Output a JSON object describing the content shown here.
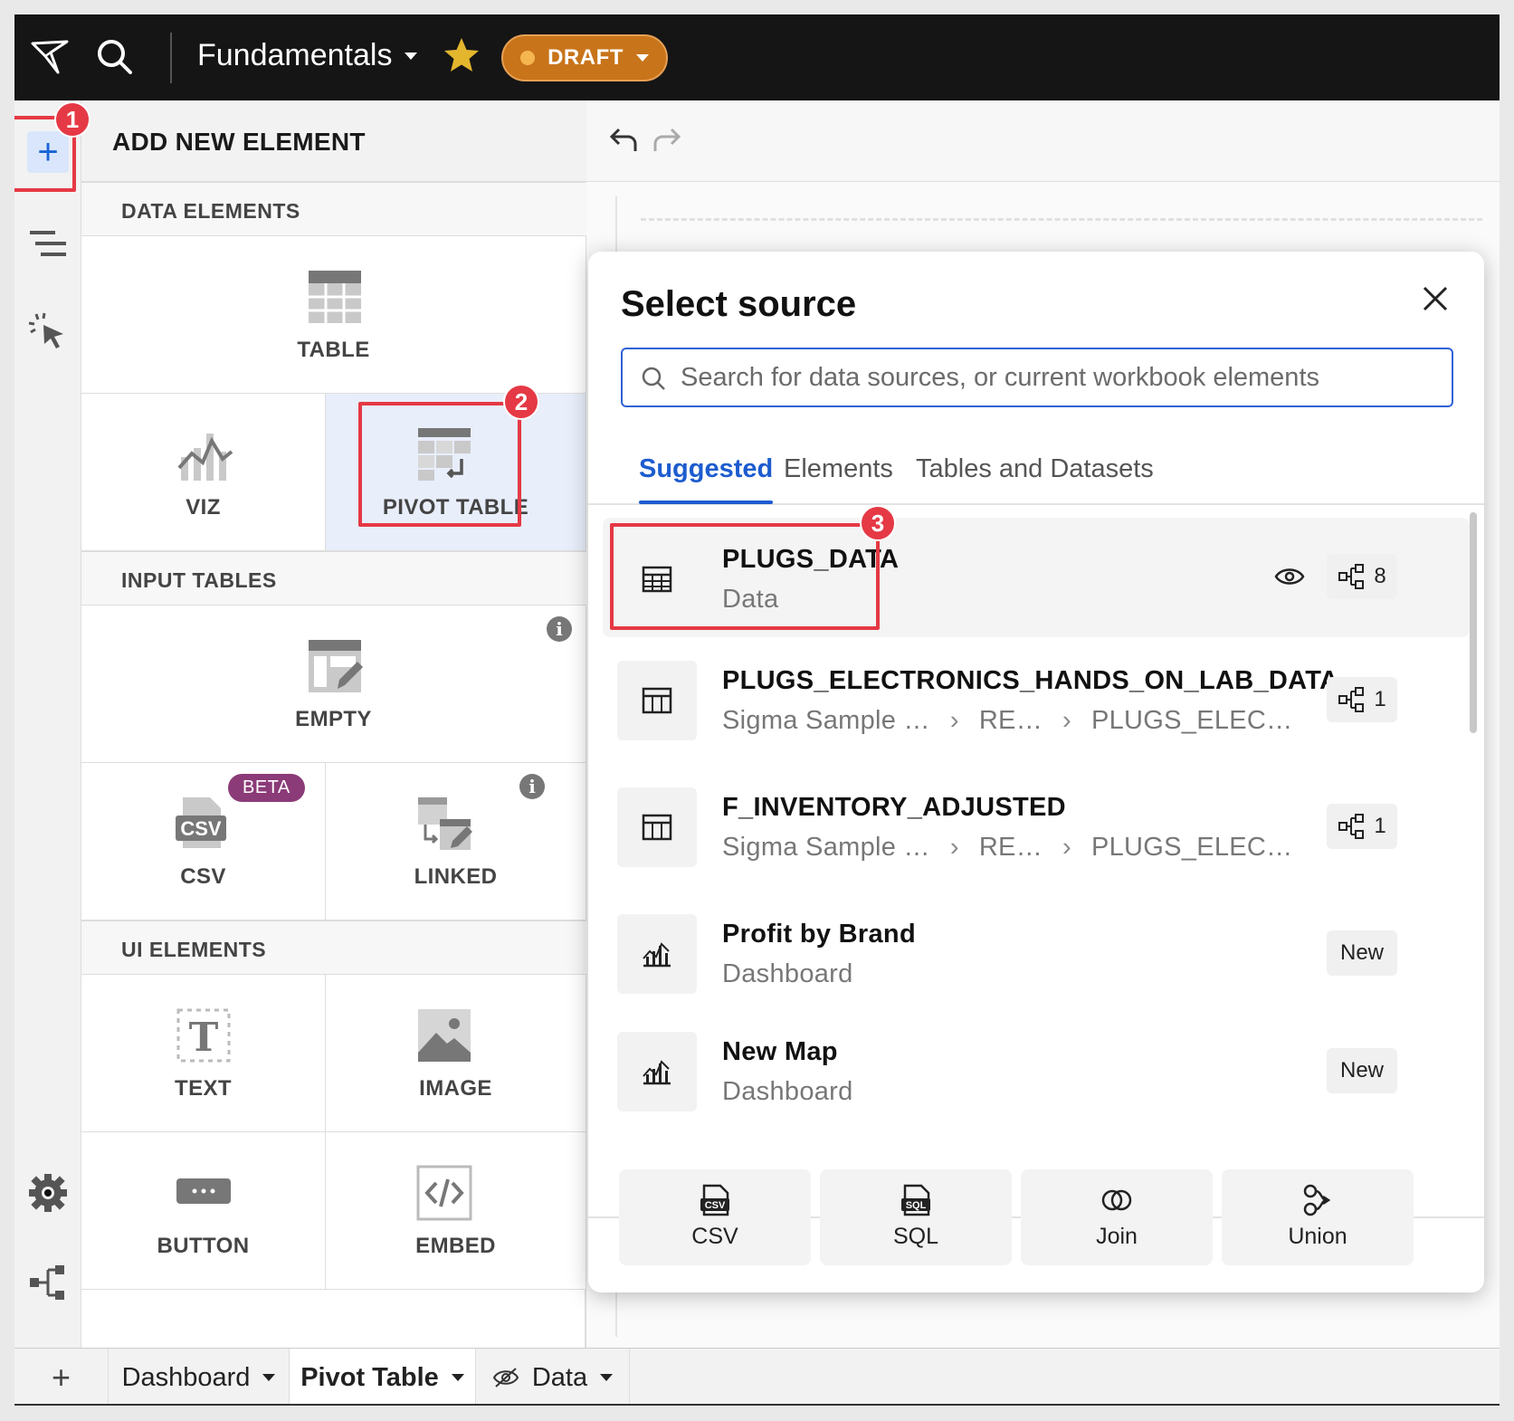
{
  "topbar": {
    "workbook_title": "Fundamentals",
    "status_label": "DRAFT"
  },
  "panel": {
    "title": "ADD NEW ELEMENT",
    "sections": {
      "data": "DATA ELEMENTS",
      "input": "INPUT TABLES",
      "ui": "UI ELEMENTS"
    },
    "tiles": {
      "table": "TABLE",
      "viz": "VIZ",
      "pivot": "PIVOT TABLE",
      "empty": "EMPTY",
      "csv": "CSV",
      "csv_badge": "BETA",
      "linked": "LINKED",
      "text": "TEXT",
      "image": "IMAGE",
      "button": "BUTTON",
      "embed": "EMBED"
    }
  },
  "callouts": [
    "1",
    "2",
    "3"
  ],
  "modal": {
    "title": "Select source",
    "search_placeholder": "Search for data sources, or current workbook elements",
    "tabs": [
      "Suggested",
      "Elements",
      "Tables and Datasets"
    ],
    "rows": [
      {
        "name": "PLUGS_DATA",
        "sub": "Data",
        "count": "8",
        "icon": "table-icon"
      },
      {
        "name": "PLUGS_ELECTRONICS_HANDS_ON_LAB_DATA",
        "path": [
          "Sigma Sample …",
          "RE…",
          "PLUGS_ELEC…"
        ],
        "count": "1",
        "icon": "dataset-icon"
      },
      {
        "name": "F_INVENTORY_ADJUSTED",
        "path": [
          "Sigma Sample …",
          "RE…",
          "PLUGS_ELEC…"
        ],
        "count": "1",
        "icon": "dataset-icon"
      },
      {
        "name": "Profit by Brand",
        "sub": "Dashboard",
        "tag": "New",
        "icon": "chart-icon"
      },
      {
        "name": "New Map",
        "sub": "Dashboard",
        "tag": "New",
        "icon": "chart-icon"
      }
    ],
    "footer_buttons": [
      "CSV",
      "SQL",
      "Join",
      "Union"
    ]
  },
  "bottom_tabs": [
    "Dashboard",
    "Pivot Table",
    "Data"
  ],
  "colors": {
    "accent": "#1d5ccf",
    "callout": "#e53945",
    "draft": "#c8741a",
    "beta": "#8b3b78"
  }
}
